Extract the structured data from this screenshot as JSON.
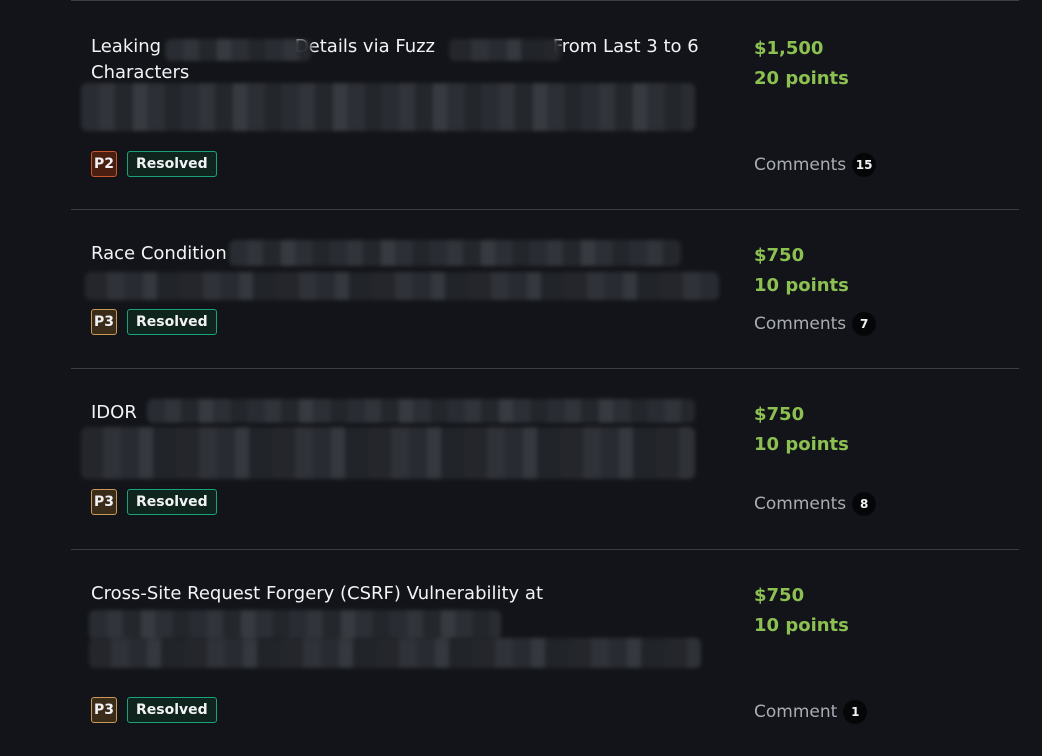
{
  "reports": [
    {
      "title": "Leaking S Details via Fuzz S From Last 3 to 6 Characters",
      "title_lead": "Leaking ",
      "title_part2": "Details via Fuzz ",
      "title_part3": "From Last 3 to 6",
      "title_line2": "Characters",
      "priority": "P2",
      "status": "Resolved",
      "bounty": "$1,500",
      "points": "20 points",
      "comments_label": "Comments",
      "comments_count": "15"
    },
    {
      "title": "Race Condition",
      "priority": "P3",
      "status": "Resolved",
      "bounty": "$750",
      "points": "10 points",
      "comments_label": "Comments",
      "comments_count": "7"
    },
    {
      "title": "IDOR",
      "priority": "P3",
      "status": "Resolved",
      "bounty": "$750",
      "points": "10 points",
      "comments_label": "Comments",
      "comments_count": "8"
    },
    {
      "title": "Cross-Site Request Forgery (CSRF) Vulnerability at",
      "priority": "P3",
      "status": "Resolved",
      "bounty": "$750",
      "points": "10 points",
      "comments_label": "Comment",
      "comments_count": "1"
    }
  ],
  "colors": {
    "background": "#121419",
    "reward_green": "#8cc152",
    "resolved_border": "#1aa37a",
    "p2_border": "#c8562a",
    "p3_border": "#c89a55"
  }
}
